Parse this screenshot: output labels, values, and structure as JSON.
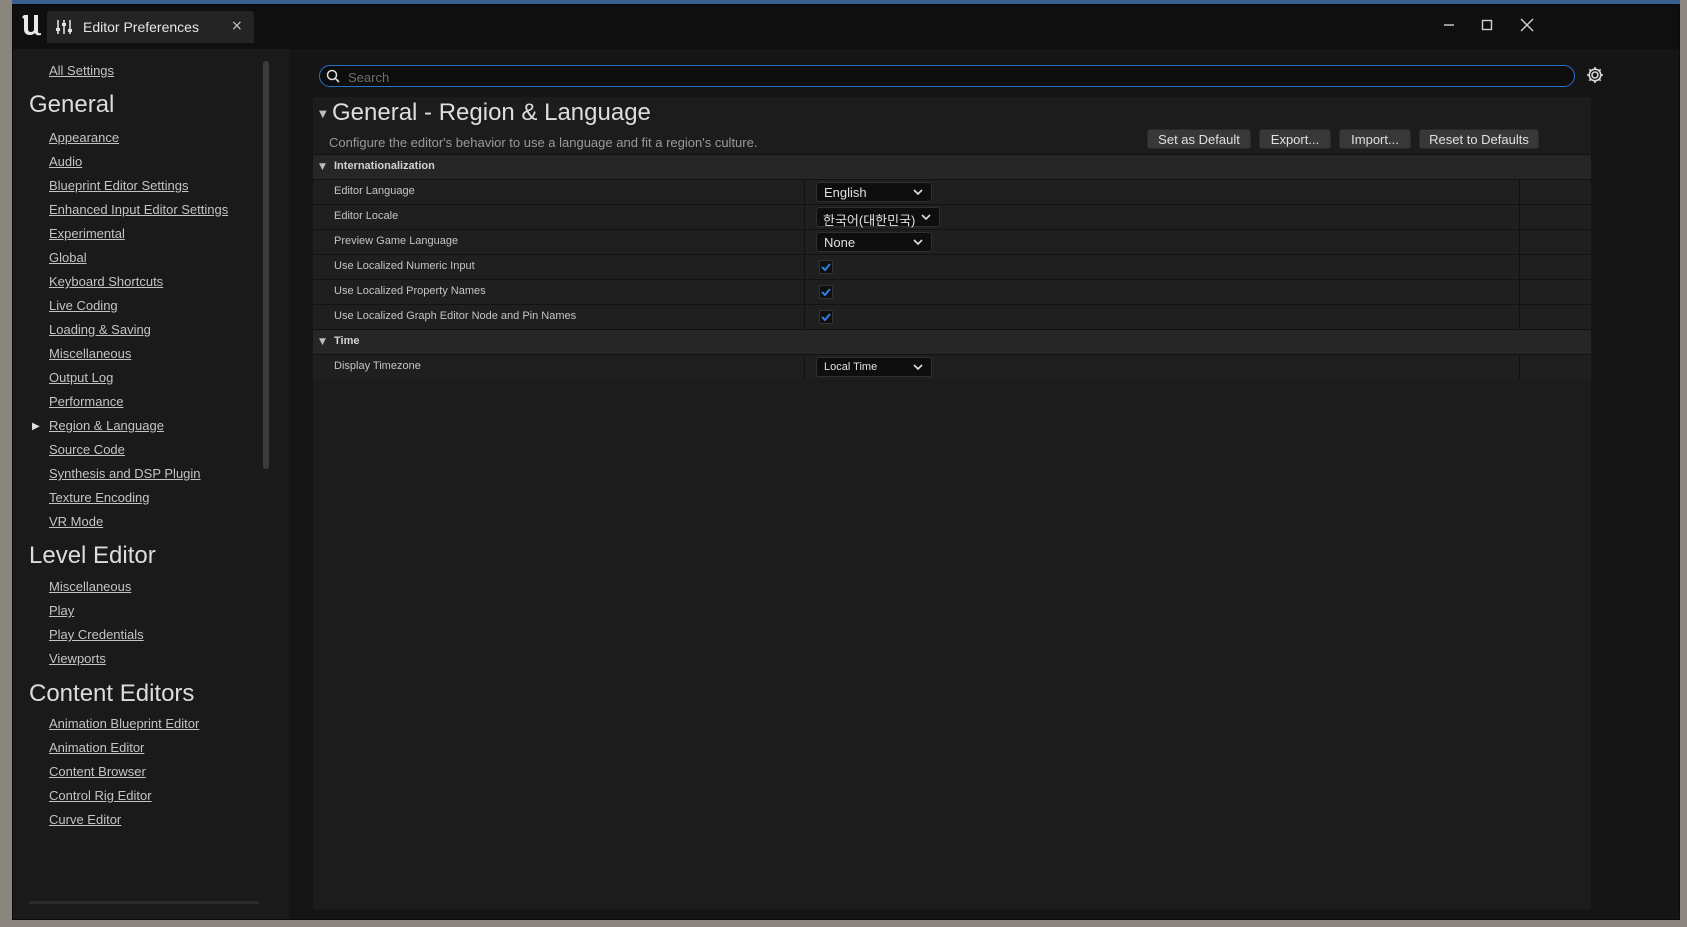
{
  "window": {
    "tab_title": "Editor Preferences",
    "tab_close": "×"
  },
  "search": {
    "placeholder": "Search",
    "value": ""
  },
  "sidebar": {
    "all_settings": "All Settings",
    "groups": [
      {
        "heading": "General",
        "items": [
          "Appearance",
          "Audio",
          "Blueprint Editor Settings",
          "Enhanced Input Editor Settings",
          "Experimental",
          "Global",
          "Keyboard Shortcuts",
          "Live Coding",
          "Loading & Saving",
          "Miscellaneous",
          "Output Log",
          "Performance",
          "Region & Language",
          "Source Code",
          "Synthesis and DSP Plugin",
          "Texture Encoding",
          "VR Mode"
        ]
      },
      {
        "heading": "Level Editor",
        "items": [
          "Miscellaneous",
          "Play",
          "Play Credentials",
          "Viewports"
        ]
      },
      {
        "heading": "Content Editors",
        "items": [
          "Animation Blueprint Editor",
          "Animation Editor",
          "Content Browser",
          "Control Rig Editor",
          "Curve Editor"
        ]
      }
    ],
    "active_item": "Region & Language"
  },
  "section": {
    "title": "General - Region & Language",
    "description": "Configure the editor's behavior to use a language and fit a region's culture.",
    "buttons": {
      "set_default": "Set as Default",
      "export": "Export...",
      "import": "Import...",
      "reset": "Reset to Defaults"
    }
  },
  "categories": {
    "internationalization": {
      "label": "Internationalization",
      "rows": {
        "editor_language": {
          "label": "Editor Language",
          "value": "English"
        },
        "editor_locale": {
          "label": "Editor Locale",
          "value": "한국어(대한민국)"
        },
        "preview_game_language": {
          "label": "Preview Game Language",
          "value": "None"
        },
        "localized_numeric": {
          "label": "Use Localized Numeric Input",
          "checked": true
        },
        "localized_property": {
          "label": "Use Localized Property Names",
          "checked": true
        },
        "localized_graph": {
          "label": "Use Localized Graph Editor Node and Pin Names",
          "checked": true
        }
      }
    },
    "time": {
      "label": "Time",
      "rows": {
        "display_timezone": {
          "label": "Display Timezone",
          "value": "Local Time"
        }
      }
    }
  },
  "colors": {
    "accent": "#2b6fc7",
    "window_bg": "#151515",
    "panel_bg": "#1c1c1c",
    "check_color": "#2f7fe0"
  },
  "icons": {
    "logo": "unreal-logo-icon",
    "tab": "sliders-icon",
    "search": "search-icon",
    "gear": "gear-icon",
    "minimize": "minimize-icon",
    "maximize": "maximize-icon",
    "close": "close-icon",
    "expand": "triangle-down-icon",
    "active": "triangle-right-icon",
    "dropdown": "chevron-down-icon",
    "check": "checkmark-icon"
  }
}
